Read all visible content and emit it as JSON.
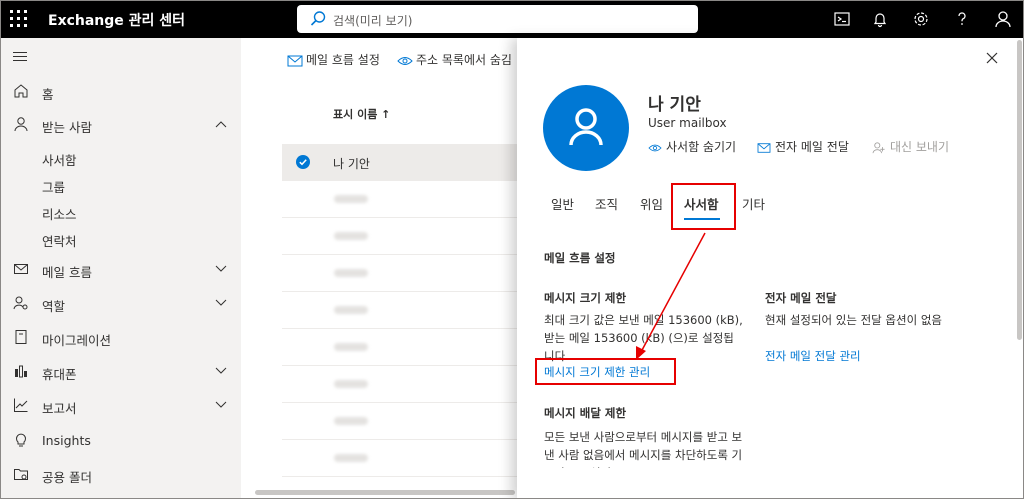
{
  "topbar": {
    "app_title": "Exchange 관리 센터",
    "search_placeholder": "검색(미리 보기)",
    "icons": [
      "waffle-icon",
      "search-icon",
      "terminal-icon",
      "bell-icon",
      "gear-icon",
      "help-icon",
      "account-icon"
    ]
  },
  "sidebar": {
    "items": [
      {
        "label": "홈",
        "icon": "home-icon"
      },
      {
        "label": "받는 사람",
        "icon": "person-icon"
      },
      {
        "label": "사서함"
      },
      {
        "label": "그룹"
      },
      {
        "label": "리소스"
      },
      {
        "label": "연락처"
      },
      {
        "label": "메일 흐름",
        "icon": "mail-icon"
      },
      {
        "label": "역할",
        "icon": "role-icon"
      },
      {
        "label": "마이그레이션",
        "icon": "migration-icon"
      },
      {
        "label": "휴대폰",
        "icon": "mobile-icon"
      },
      {
        "label": "보고서",
        "icon": "report-icon"
      },
      {
        "label": "Insights",
        "icon": "insights-icon"
      },
      {
        "label": "공용 폴더",
        "icon": "folder-icon"
      }
    ]
  },
  "main": {
    "commands": [
      "메일 흐름 설정",
      "주소 목록에서 숨김"
    ],
    "column_header": "표시 이름 ↑",
    "rows": [
      {
        "name": "나 기안",
        "selected": true
      }
    ]
  },
  "panel": {
    "user_name": "나 기안",
    "user_type": "User mailbox",
    "actions": [
      {
        "label": "사서함 숨기기"
      },
      {
        "label": "전자 메일 전달"
      },
      {
        "label": "대신 보내기",
        "disabled": true
      }
    ],
    "tabs": [
      "일반",
      "조직",
      "위임",
      "사서함",
      "기타"
    ],
    "active_tab": "사서함",
    "mail_flow_title": "메일 흐름 설정",
    "size_limit": {
      "title": "메시지 크기 제한",
      "text": "최대 크기 값은 보낸 메일 153600 (kB), 받는 메일 153600 (kB) (으)로 설정됩니다.",
      "link": "메시지 크기 제한 관리"
    },
    "forwarding": {
      "title": "전자 메일 전달",
      "text": "현재 설정되어 있는 전달 옵션이 없음",
      "link": "전자 메일 전달 관리"
    },
    "delivery_limit": {
      "title": "메시지 배달 제한",
      "text": "모든 보낸 사람으로부터 메시지를 받고 보낸 사람 없음에서 메시지를 차단하도록 기본값으로 설정"
    }
  },
  "colors": {
    "accent": "#0078d4",
    "annotation": "#e60000"
  }
}
